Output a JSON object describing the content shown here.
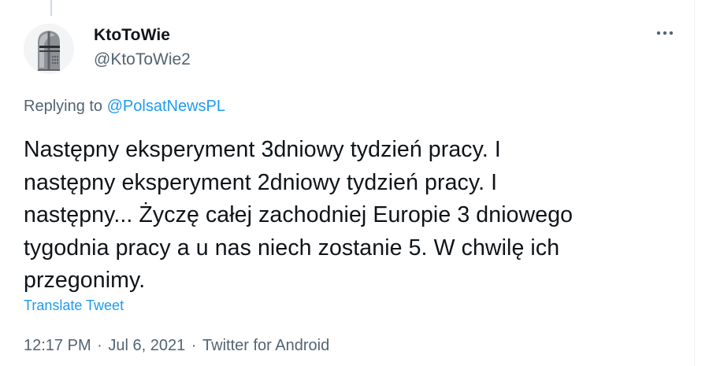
{
  "tweet": {
    "author": {
      "name": "KtoToWie",
      "handle": "@KtoToWie2",
      "avatar_icon": "knight-helmet-avatar"
    },
    "more_icon": "more-options-icon",
    "replying": {
      "prefix": "Replying to ",
      "mention": "@PolsatNewsPL"
    },
    "text_lines": [
      "Następny eksperyment 3dniowy tydzień pracy. I",
      "następny eksperyment 2dniowy tydzień pracy. I",
      "następny... Życzę całej zachodniej Europie 3 dniowego",
      "tygodnia pracy a u nas niech zostanie 5. W chwilę ich",
      "przegonimy."
    ],
    "translate_label": "Translate Tweet",
    "meta": {
      "time": "12:17 PM",
      "separator": " · ",
      "date": "Jul 6, 2021",
      "source": "Twitter for Android"
    }
  },
  "colors": {
    "text_primary": "#0f1419",
    "text_secondary": "#536471",
    "accent": "#1d9bf0"
  }
}
